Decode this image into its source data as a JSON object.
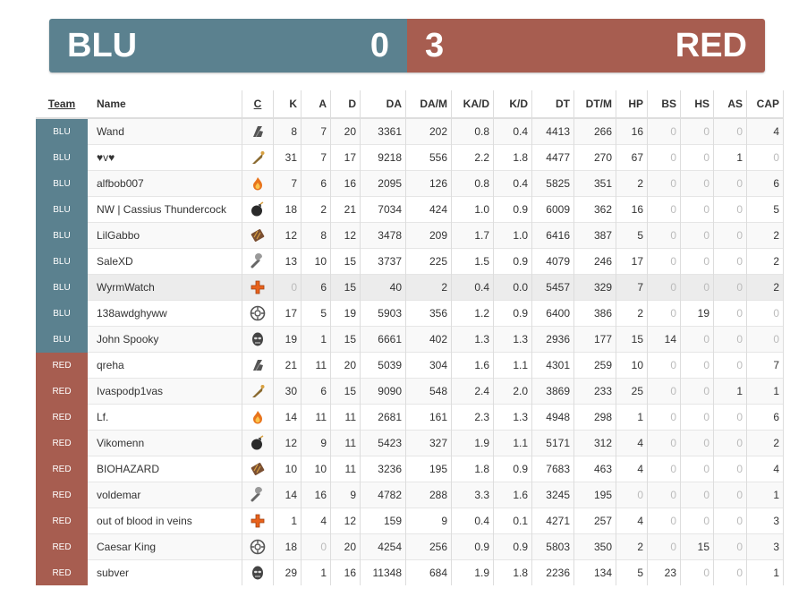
{
  "score": {
    "blu_name": "BLU",
    "blu_score": "0",
    "red_name": "RED",
    "red_score": "3",
    "blu_color": "#5b818f",
    "red_color": "#a75d50"
  },
  "columns": [
    "Team",
    "Name",
    "C",
    "K",
    "A",
    "D",
    "DA",
    "DA/M",
    "KA/D",
    "K/D",
    "DT",
    "DT/M",
    "HP",
    "BS",
    "HS",
    "AS",
    "CAP"
  ],
  "players": [
    {
      "team": "BLU",
      "name": "Wand",
      "class": "scout",
      "cells": [
        "8",
        "7",
        "20",
        "3361",
        "202",
        "0.8",
        "0.4",
        "4413",
        "266",
        "16",
        "0",
        "0",
        "0",
        "4"
      ]
    },
    {
      "team": "BLU",
      "name": "♥v♥",
      "class": "soldier",
      "cells": [
        "31",
        "7",
        "17",
        "9218",
        "556",
        "2.2",
        "1.8",
        "4477",
        "270",
        "67",
        "0",
        "0",
        "1",
        "0"
      ]
    },
    {
      "team": "BLU",
      "name": "alfbob007",
      "class": "pyro",
      "cells": [
        "7",
        "6",
        "16",
        "2095",
        "126",
        "0.8",
        "0.4",
        "5825",
        "351",
        "2",
        "0",
        "0",
        "0",
        "6"
      ]
    },
    {
      "team": "BLU",
      "name": "NW | Cassius Thundercock",
      "class": "demoman",
      "cells": [
        "18",
        "2",
        "21",
        "7034",
        "424",
        "1.0",
        "0.9",
        "6009",
        "362",
        "16",
        "0",
        "0",
        "0",
        "5"
      ]
    },
    {
      "team": "BLU",
      "name": "LilGabbo",
      "class": "heavy",
      "cells": [
        "12",
        "8",
        "12",
        "3478",
        "209",
        "1.7",
        "1.0",
        "6416",
        "387",
        "5",
        "0",
        "0",
        "0",
        "2"
      ]
    },
    {
      "team": "BLU",
      "name": "SaleXD",
      "class": "engineer",
      "cells": [
        "13",
        "10",
        "15",
        "3737",
        "225",
        "1.5",
        "0.9",
        "4079",
        "246",
        "17",
        "0",
        "0",
        "0",
        "2"
      ]
    },
    {
      "team": "BLU",
      "name": "WyrmWatch",
      "class": "medic",
      "cells": [
        "0",
        "6",
        "15",
        "40",
        "2",
        "0.4",
        "0.0",
        "5457",
        "329",
        "7",
        "0",
        "0",
        "0",
        "2"
      ]
    },
    {
      "team": "BLU",
      "name": "138awdghyww",
      "class": "sniper",
      "cells": [
        "17",
        "5",
        "19",
        "5903",
        "356",
        "1.2",
        "0.9",
        "6400",
        "386",
        "2",
        "0",
        "19",
        "0",
        "0"
      ]
    },
    {
      "team": "BLU",
      "name": "John Spooky",
      "class": "spy",
      "cells": [
        "19",
        "1",
        "15",
        "6661",
        "402",
        "1.3",
        "1.3",
        "2936",
        "177",
        "15",
        "14",
        "0",
        "0",
        "0"
      ]
    },
    {
      "team": "RED",
      "name": "qreha",
      "class": "scout",
      "cells": [
        "21",
        "11",
        "20",
        "5039",
        "304",
        "1.6",
        "1.1",
        "4301",
        "259",
        "10",
        "0",
        "0",
        "0",
        "7"
      ]
    },
    {
      "team": "RED",
      "name": "Ivaspodp1vas",
      "class": "soldier",
      "cells": [
        "30",
        "6",
        "15",
        "9090",
        "548",
        "2.4",
        "2.0",
        "3869",
        "233",
        "25",
        "0",
        "0",
        "1",
        "1"
      ]
    },
    {
      "team": "RED",
      "name": "Lf.",
      "class": "pyro",
      "cells": [
        "14",
        "11",
        "11",
        "2681",
        "161",
        "2.3",
        "1.3",
        "4948",
        "298",
        "1",
        "0",
        "0",
        "0",
        "6"
      ]
    },
    {
      "team": "RED",
      "name": "Vikomenn",
      "class": "demoman",
      "cells": [
        "12",
        "9",
        "11",
        "5423",
        "327",
        "1.9",
        "1.1",
        "5171",
        "312",
        "4",
        "0",
        "0",
        "0",
        "2"
      ]
    },
    {
      "team": "RED",
      "name": "BIOHAZARD",
      "class": "heavy",
      "cells": [
        "10",
        "10",
        "11",
        "3236",
        "195",
        "1.8",
        "0.9",
        "7683",
        "463",
        "4",
        "0",
        "0",
        "0",
        "4"
      ]
    },
    {
      "team": "RED",
      "name": "voldemar",
      "class": "engineer",
      "cells": [
        "14",
        "16",
        "9",
        "4782",
        "288",
        "3.3",
        "1.6",
        "3245",
        "195",
        "0",
        "0",
        "0",
        "0",
        "1"
      ]
    },
    {
      "team": "RED",
      "name": "out of blood in veins",
      "class": "medic",
      "cells": [
        "1",
        "4",
        "12",
        "159",
        "9",
        "0.4",
        "0.1",
        "4271",
        "257",
        "4",
        "0",
        "0",
        "0",
        "3"
      ]
    },
    {
      "team": "RED",
      "name": "Caesar King",
      "class": "sniper",
      "cells": [
        "18",
        "0",
        "20",
        "4254",
        "256",
        "0.9",
        "0.9",
        "5803",
        "350",
        "2",
        "0",
        "15",
        "0",
        "3"
      ]
    },
    {
      "team": "RED",
      "name": "subver",
      "class": "spy",
      "cells": [
        "29",
        "1",
        "16",
        "11348",
        "684",
        "1.9",
        "1.8",
        "2236",
        "134",
        "5",
        "23",
        "0",
        "0",
        "1"
      ]
    }
  ]
}
